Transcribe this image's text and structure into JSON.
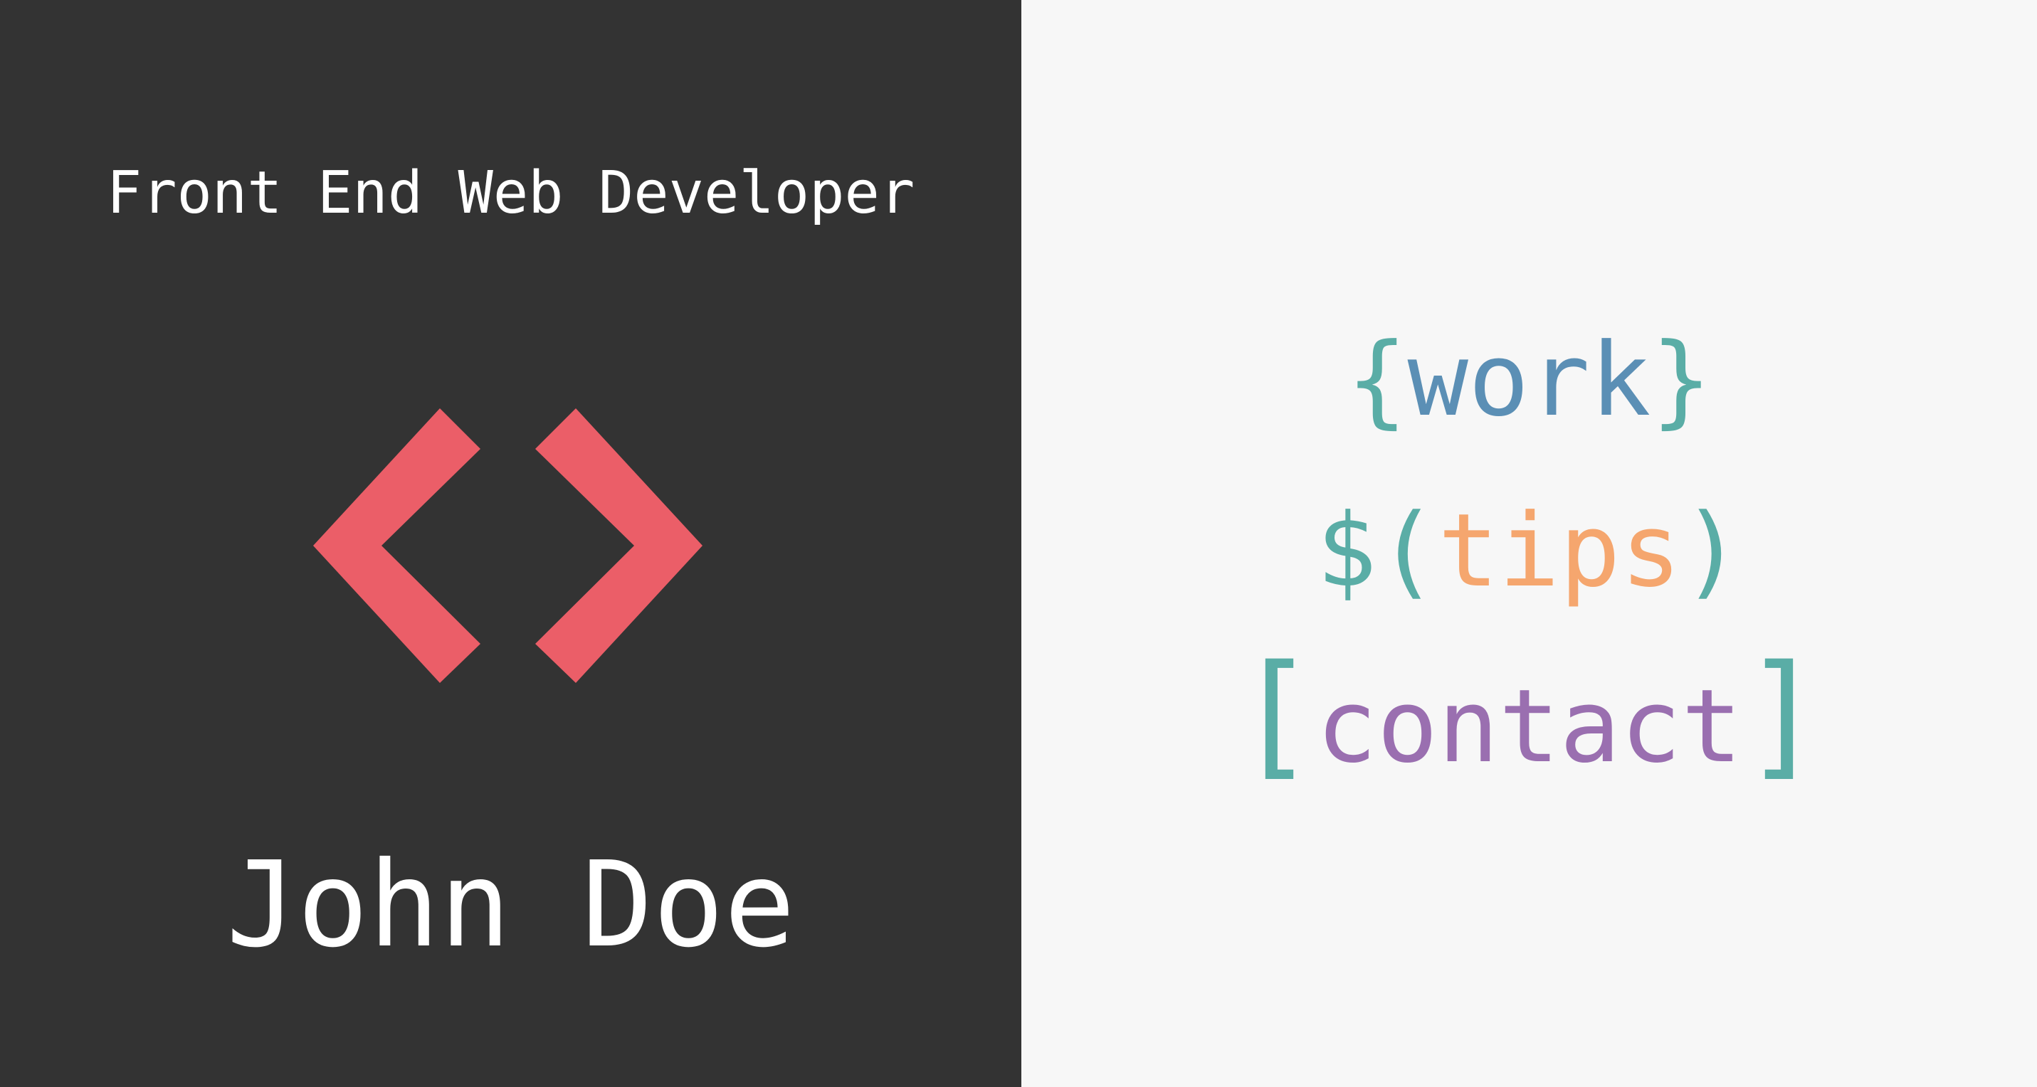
{
  "header": {
    "job_title": "Front End Web Developer",
    "owner_name": "John Doe"
  },
  "logo": {
    "icon": "code-brackets-icon",
    "color": "#eb5e68"
  },
  "nav": {
    "work": {
      "open": "{",
      "label": "work",
      "close": "}"
    },
    "tips": {
      "prefix": "$",
      "open": "(",
      "label": "tips",
      "close": ")"
    },
    "contact": {
      "open": "[",
      "label": "contact",
      "close": "]"
    }
  },
  "colors": {
    "left_background": "#333333",
    "right_background": "#f7f7f7",
    "text_light": "#ffffff",
    "accent_teal": "#5aada6",
    "work_blue": "#5b8fb5",
    "tips_orange": "#f5a66e",
    "contact_purple": "#9a6fb0"
  }
}
